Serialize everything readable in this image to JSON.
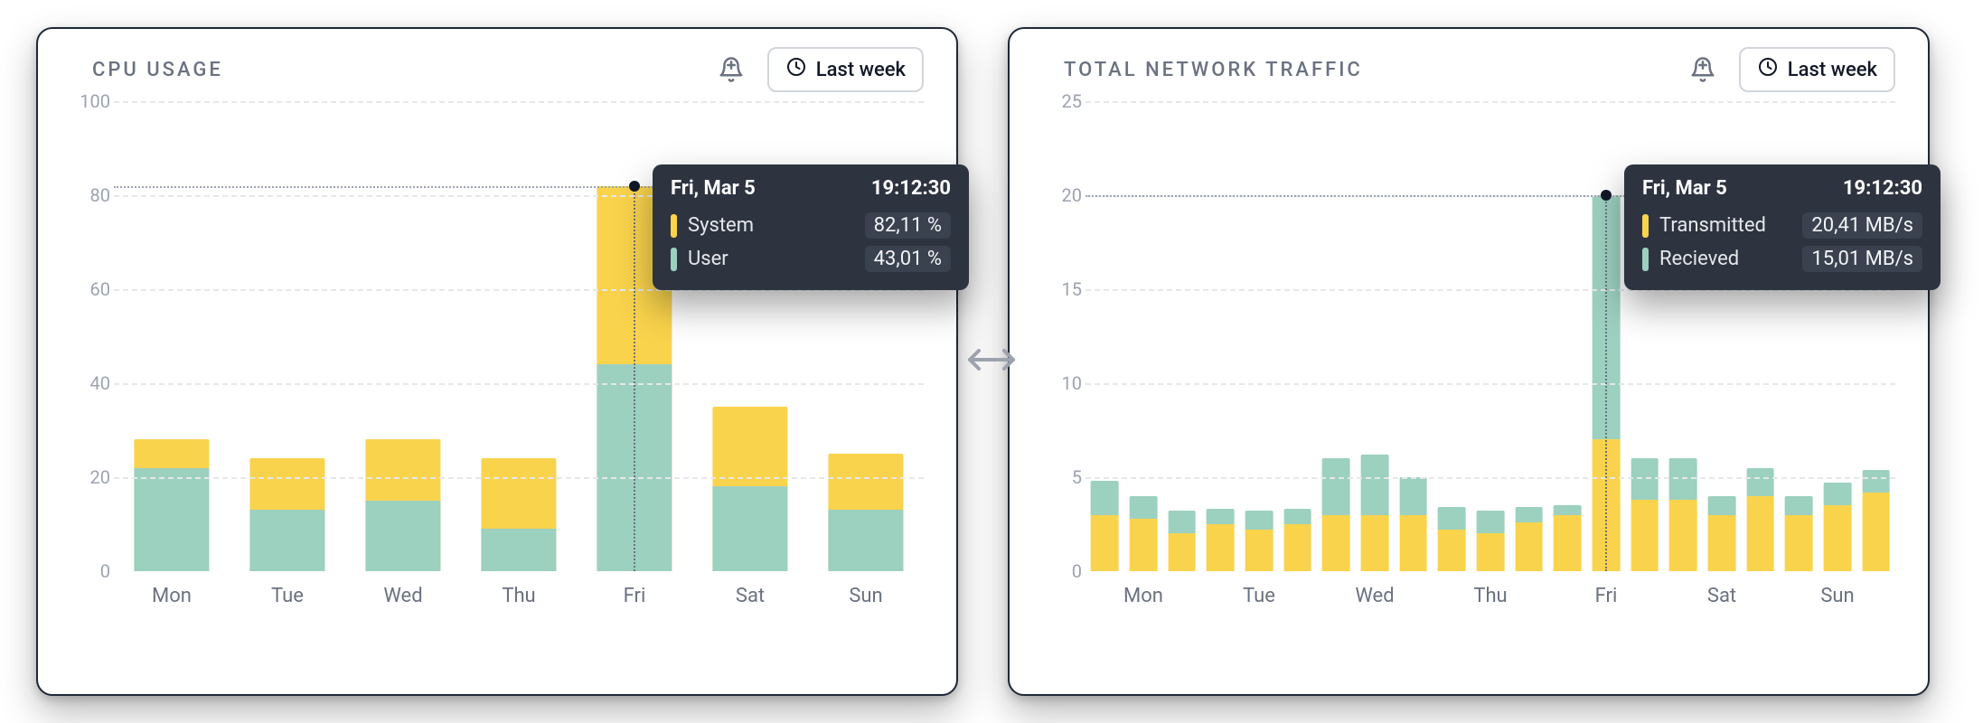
{
  "range_button_label": "Last week",
  "colors": {
    "series_a": "#f9d34c",
    "series_b": "#9cd0bf",
    "tooltip_bg": "#2d3440"
  },
  "cpu": {
    "title": "CPU USAGE",
    "y_ticks": [
      "0",
      "20",
      "40",
      "60",
      "80",
      "100"
    ],
    "x_labels": [
      "Mon",
      "Tue",
      "Wed",
      "Thu",
      "Fri",
      "Sat",
      "Sun"
    ],
    "tooltip": {
      "date": "Fri, Mar 5",
      "time": "19:12:30",
      "rows": [
        {
          "label": "System",
          "value": "82,11 %"
        },
        {
          "label": "User",
          "value": "43,01 %"
        }
      ]
    }
  },
  "net": {
    "title": "TOTAL NETWORK TRAFFIC",
    "y_ticks": [
      "0",
      "5",
      "10",
      "15",
      "20",
      "25"
    ],
    "x_labels": [
      "Mon",
      "Tue",
      "Wed",
      "Thu",
      "Fri",
      "Sat",
      "Sun"
    ],
    "tooltip": {
      "date": "Fri, Mar 5",
      "time": "19:12:30",
      "rows": [
        {
          "label": "Transmitted",
          "value": "20,41 MB/s"
        },
        {
          "label": "Recieved",
          "value": "15,01 MB/s"
        }
      ]
    }
  },
  "chart_data": [
    {
      "id": "cpu",
      "type": "bar",
      "title": "CPU USAGE",
      "xlabel": "",
      "ylabel": "",
      "ylim": [
        0,
        100
      ],
      "categories": [
        "Mon",
        "Tue",
        "Wed",
        "Thu",
        "Fri",
        "Sat",
        "Sun"
      ],
      "stacked": false,
      "series": [
        {
          "name": "System",
          "color": "#f9d34c",
          "values": [
            28,
            24,
            28,
            24,
            82,
            35,
            25
          ]
        },
        {
          "name": "User",
          "color": "#9cd0bf",
          "values": [
            22,
            13,
            15,
            9,
            44,
            18,
            13
          ]
        }
      ],
      "highlight": {
        "category": "Fri",
        "date": "Fri, Mar 5",
        "time": "19:12:30",
        "System": "82,11 %",
        "User": "43,01 %"
      }
    },
    {
      "id": "net",
      "type": "bar",
      "title": "TOTAL NETWORK TRAFFIC",
      "xlabel": "",
      "ylabel": "",
      "ylim": [
        0,
        25
      ],
      "categories": [
        "Mon",
        "Tue",
        "Wed",
        "Thu",
        "Fri",
        "Sat",
        "Sun"
      ],
      "points_per_category": 3,
      "stacked": true,
      "series": [
        {
          "name": "Transmitted",
          "color": "#f9d34c",
          "values": [
            3.0,
            2.8,
            2.0,
            2.5,
            2.2,
            2.5,
            3.0,
            3.0,
            3.0,
            2.2,
            2.0,
            2.6,
            3.0,
            7.0,
            3.8,
            3.8,
            3.0,
            4.0,
            3.0,
            3.5,
            4.2
          ]
        },
        {
          "name": "Recieved",
          "color": "#9cd0bf",
          "values": [
            1.8,
            1.2,
            1.2,
            0.8,
            1.0,
            0.8,
            3.0,
            3.2,
            2.0,
            1.2,
            1.2,
            0.8,
            0.5,
            13.0,
            2.2,
            2.2,
            1.0,
            1.5,
            1.0,
            1.2,
            1.2
          ]
        }
      ],
      "highlight": {
        "index": 13,
        "date": "Fri, Mar 5",
        "time": "19:12:30",
        "Transmitted": "20,41 MB/s",
        "Recieved": "15,01 MB/s"
      }
    }
  ]
}
